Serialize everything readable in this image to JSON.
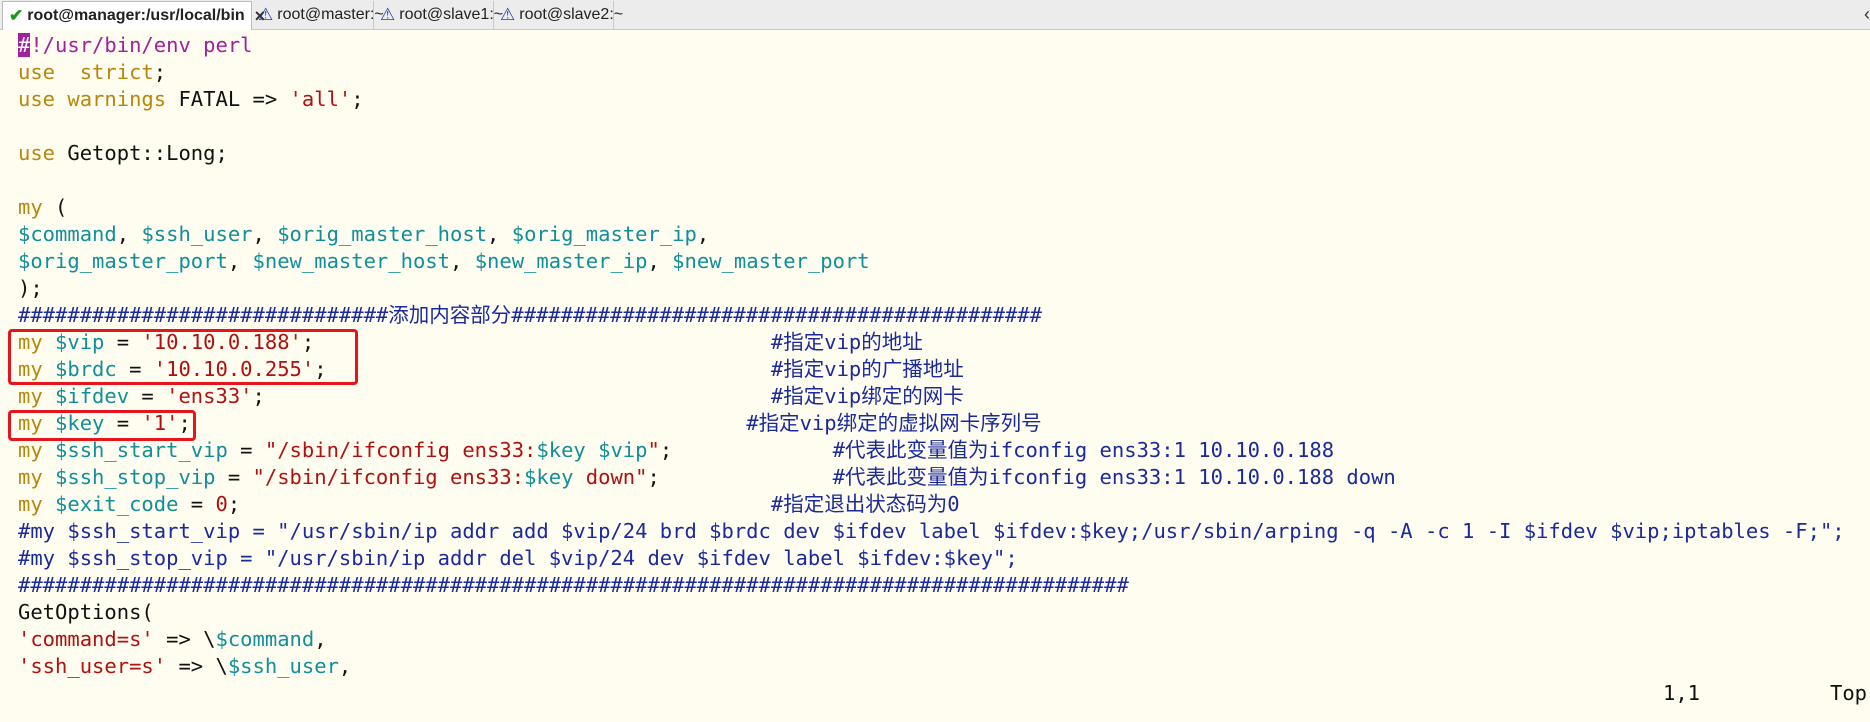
{
  "tabs": [
    {
      "title": "root@manager:/usr/local/bin",
      "status": "connected",
      "icon": "check-icon",
      "active": true,
      "close": "×"
    },
    {
      "title": "root@master:~",
      "status": "warning",
      "icon": "warning-icon"
    },
    {
      "title": "root@slave1:~",
      "status": "warning",
      "icon": "warning-icon"
    },
    {
      "title": "root@slave2:~",
      "status": "warning",
      "icon": "warning-icon"
    }
  ],
  "tab_scroll_arrow": "‹",
  "editor": {
    "lines": [
      [
        [
          "cursor",
          "#"
        ],
        [
          "kw2",
          "!/usr/bin/env perl"
        ]
      ],
      [
        [
          "kw",
          "use"
        ],
        [
          "",
          "  "
        ],
        [
          "kw",
          "strict"
        ],
        [
          "",
          ";"
        ]
      ],
      [
        [
          "kw",
          "use"
        ],
        [
          "",
          ""
        ],
        [
          "kw",
          " warnings"
        ],
        [
          "",
          " FATAL => "
        ],
        [
          "str",
          "'all'"
        ],
        [
          "",
          ";"
        ]
      ],
      [],
      [
        [
          "kw",
          "use"
        ],
        [
          "",
          " Getopt::Long;"
        ]
      ],
      [],
      [
        [
          "kw",
          "my"
        ],
        [
          "",
          " ("
        ]
      ],
      [
        [
          "var",
          "$command"
        ],
        [
          "",
          ", "
        ],
        [
          "var",
          "$ssh_user"
        ],
        [
          "",
          ", "
        ],
        [
          "var",
          "$orig_master_host"
        ],
        [
          "",
          ", "
        ],
        [
          "var",
          "$orig_master_ip"
        ],
        [
          "",
          ","
        ]
      ],
      [
        [
          "var",
          "$orig_master_port"
        ],
        [
          "",
          ", "
        ],
        [
          "var",
          "$new_master_host"
        ],
        [
          "",
          ", "
        ],
        [
          "var",
          "$new_master_ip"
        ],
        [
          "",
          ", "
        ],
        [
          "var",
          "$new_master_port"
        ]
      ],
      [
        [
          "",
          ");"
        ]
      ],
      [
        [
          "cmt",
          "##############################"
        ],
        [
          "cmtcjk",
          "添加内容部分"
        ],
        [
          "cmt",
          "###########################################"
        ]
      ],
      [
        [
          "kw",
          "my"
        ],
        [
          "",
          " "
        ],
        [
          "var",
          "$vip"
        ],
        [
          "",
          " = "
        ],
        [
          "str",
          "'10.10.0.188'"
        ],
        [
          "",
          ";"
        ],
        [
          "pad",
          "                                     "
        ],
        [
          "cmt",
          "#"
        ],
        [
          "cmtcjk",
          "指定"
        ],
        [
          "cmth",
          "vip"
        ],
        [
          "cmtcjk",
          "的地址"
        ]
      ],
      [
        [
          "kw",
          "my"
        ],
        [
          "",
          " "
        ],
        [
          "var",
          "$brdc"
        ],
        [
          "",
          " = "
        ],
        [
          "str",
          "'10.10.0.255'"
        ],
        [
          "",
          ";"
        ],
        [
          "pad",
          "                                    "
        ],
        [
          "cmt",
          "#"
        ],
        [
          "cmtcjk",
          "指定"
        ],
        [
          "cmth",
          "vip"
        ],
        [
          "cmtcjk",
          "的广播地址"
        ]
      ],
      [
        [
          "kw",
          "my"
        ],
        [
          "",
          " "
        ],
        [
          "var",
          "$ifdev"
        ],
        [
          "",
          " = "
        ],
        [
          "str",
          "'ens33'"
        ],
        [
          "",
          ";"
        ],
        [
          "pad",
          "                                         "
        ],
        [
          "cmt",
          "#"
        ],
        [
          "cmtcjk",
          "指定"
        ],
        [
          "cmth",
          "vip"
        ],
        [
          "cmtcjk",
          "绑定的网卡"
        ]
      ],
      [
        [
          "kw",
          "my"
        ],
        [
          "",
          " "
        ],
        [
          "var",
          "$key"
        ],
        [
          "",
          " = "
        ],
        [
          "str",
          "'1'"
        ],
        [
          "",
          ";"
        ],
        [
          "pad",
          "                                             "
        ],
        [
          "cmt",
          "#"
        ],
        [
          "cmtcjk",
          "指定"
        ],
        [
          "cmth",
          "vip"
        ],
        [
          "cmtcjk",
          "绑定的虚拟网卡序列号"
        ]
      ],
      [
        [
          "kw",
          "my"
        ],
        [
          "",
          " "
        ],
        [
          "var",
          "$ssh_start_vip"
        ],
        [
          "",
          " = "
        ],
        [
          "str",
          "\"/sbin/ifconfig ens33:"
        ],
        [
          "var",
          "$key"
        ],
        [
          "",
          " "
        ],
        [
          "var",
          "$vip"
        ],
        [
          "str",
          "\""
        ],
        [
          "",
          ";"
        ],
        [
          "pad",
          "             "
        ],
        [
          "cmt",
          "#"
        ],
        [
          "cmtcjk",
          "代表此变量值为"
        ],
        [
          "cmth",
          "ifconfig ens33:1 10.10.0.188"
        ]
      ],
      [
        [
          "kw",
          "my"
        ],
        [
          "",
          " "
        ],
        [
          "var",
          "$ssh_stop_vip"
        ],
        [
          "",
          " = "
        ],
        [
          "str",
          "\"/sbin/ifconfig ens33:"
        ],
        [
          "var",
          "$key"
        ],
        [
          "str",
          " down\""
        ],
        [
          "",
          ";"
        ],
        [
          "pad",
          "              "
        ],
        [
          "cmt",
          "#"
        ],
        [
          "cmtcjk",
          "代表此变量值为"
        ],
        [
          "cmth",
          "ifconfig ens33:1 10.10.0.188 down"
        ]
      ],
      [
        [
          "kw",
          "my"
        ],
        [
          "",
          " "
        ],
        [
          "var",
          "$exit_code"
        ],
        [
          "",
          " = "
        ],
        [
          "str",
          "0"
        ],
        [
          "",
          ";"
        ],
        [
          "pad",
          "                                           "
        ],
        [
          "cmt",
          "#"
        ],
        [
          "cmtcjk",
          "指定退出状态码为"
        ],
        [
          "cmth",
          "0"
        ]
      ],
      [
        [
          "cmt",
          "#my $ssh_start_vip = \"/usr/sbin/ip addr add $vip/24 brd $brdc dev $ifdev label $ifdev:$key;/usr/sbin/arping -q -A -c 1 -I $ifdev $vip;iptables -F;\";"
        ]
      ],
      [
        [
          "cmt",
          "#my $ssh_stop_vip = \"/usr/sbin/ip addr del $vip/24 dev $ifdev label $ifdev:$key\";"
        ]
      ],
      [
        [
          "cmt",
          "##########################################################################################"
        ]
      ],
      [
        [
          "",
          "GetOptions("
        ]
      ],
      [
        [
          "str",
          "'command=s'"
        ],
        [
          "",
          " => \\"
        ],
        [
          "var",
          "$command"
        ],
        [
          "",
          ","
        ]
      ],
      [
        [
          "str",
          "'ssh_user=s'"
        ],
        [
          "",
          " => \\"
        ],
        [
          "var",
          "$ssh_user"
        ],
        [
          "",
          ","
        ]
      ]
    ]
  },
  "status_bar": {
    "position": "1,1",
    "scroll": "Top"
  },
  "colors": {
    "keyword": "#b8860b",
    "variable": "#108f9a",
    "string": "#b01010",
    "comment": "#1a2a9c",
    "highlight_box": "#e5141d",
    "background": "#fffdf0"
  }
}
